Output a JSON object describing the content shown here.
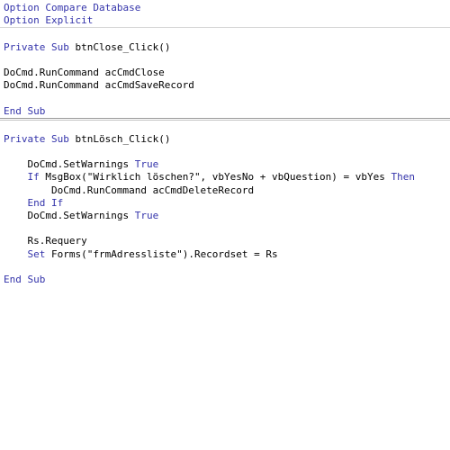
{
  "editor": {
    "language": "vba",
    "colors": {
      "background": "#ffffff",
      "keyword": "#3333aa",
      "identifier": "#000000",
      "separator_light": "#d6d6d6",
      "separator_dark": "#9a9a9a"
    }
  },
  "declarations": {
    "lines": [
      {
        "segments": [
          {
            "text": "Option Compare Database",
            "kind": "keyword"
          }
        ]
      },
      {
        "segments": [
          {
            "text": "Option Explicit",
            "kind": "keyword"
          }
        ]
      }
    ]
  },
  "procedures": [
    {
      "name": "btnClose_Click",
      "lines": [
        {
          "segments": [
            {
              "text": "",
              "kind": "plain"
            }
          ]
        },
        {
          "segments": [
            {
              "text": "Private Sub ",
              "kind": "keyword"
            },
            {
              "text": "btnClose_Click()",
              "kind": "plain"
            }
          ]
        },
        {
          "segments": [
            {
              "text": "",
              "kind": "plain"
            }
          ]
        },
        {
          "segments": [
            {
              "text": "DoCmd.RunCommand acCmdClose",
              "kind": "plain"
            }
          ]
        },
        {
          "segments": [
            {
              "text": "DoCmd.RunCommand acCmdSaveRecord",
              "kind": "plain"
            }
          ]
        },
        {
          "segments": [
            {
              "text": "",
              "kind": "plain"
            }
          ]
        },
        {
          "segments": [
            {
              "text": "End Sub",
              "kind": "keyword"
            }
          ]
        }
      ]
    },
    {
      "name": "btnLösch_Click",
      "lines": [
        {
          "segments": [
            {
              "text": "",
              "kind": "plain"
            }
          ]
        },
        {
          "segments": [
            {
              "text": "Private Sub ",
              "kind": "keyword"
            },
            {
              "text": "btnLösch_Click()",
              "kind": "plain"
            }
          ]
        },
        {
          "segments": [
            {
              "text": "",
              "kind": "plain"
            }
          ]
        },
        {
          "segments": [
            {
              "text": "    DoCmd.SetWarnings ",
              "kind": "plain"
            },
            {
              "text": "True",
              "kind": "keyword"
            }
          ]
        },
        {
          "segments": [
            {
              "text": "    ",
              "kind": "plain"
            },
            {
              "text": "If ",
              "kind": "keyword"
            },
            {
              "text": "MsgBox(\"Wirklich löschen?\", vbYesNo + vbQuestion) = vbYes ",
              "kind": "plain"
            },
            {
              "text": "Then",
              "kind": "keyword"
            }
          ]
        },
        {
          "segments": [
            {
              "text": "        DoCmd.RunCommand acCmdDeleteRecord",
              "kind": "plain"
            }
          ]
        },
        {
          "segments": [
            {
              "text": "    ",
              "kind": "plain"
            },
            {
              "text": "End If",
              "kind": "keyword"
            }
          ]
        },
        {
          "segments": [
            {
              "text": "    DoCmd.SetWarnings ",
              "kind": "plain"
            },
            {
              "text": "True",
              "kind": "keyword"
            }
          ]
        },
        {
          "segments": [
            {
              "text": "",
              "kind": "plain"
            }
          ]
        },
        {
          "segments": [
            {
              "text": "    Rs.Requery",
              "kind": "plain"
            }
          ]
        },
        {
          "segments": [
            {
              "text": "    ",
              "kind": "plain"
            },
            {
              "text": "Set ",
              "kind": "keyword"
            },
            {
              "text": "Forms(\"frmAdressliste\").Recordset = Rs",
              "kind": "plain"
            }
          ]
        },
        {
          "segments": [
            {
              "text": "",
              "kind": "plain"
            }
          ]
        },
        {
          "segments": [
            {
              "text": "End Sub",
              "kind": "keyword"
            }
          ]
        }
      ]
    }
  ]
}
